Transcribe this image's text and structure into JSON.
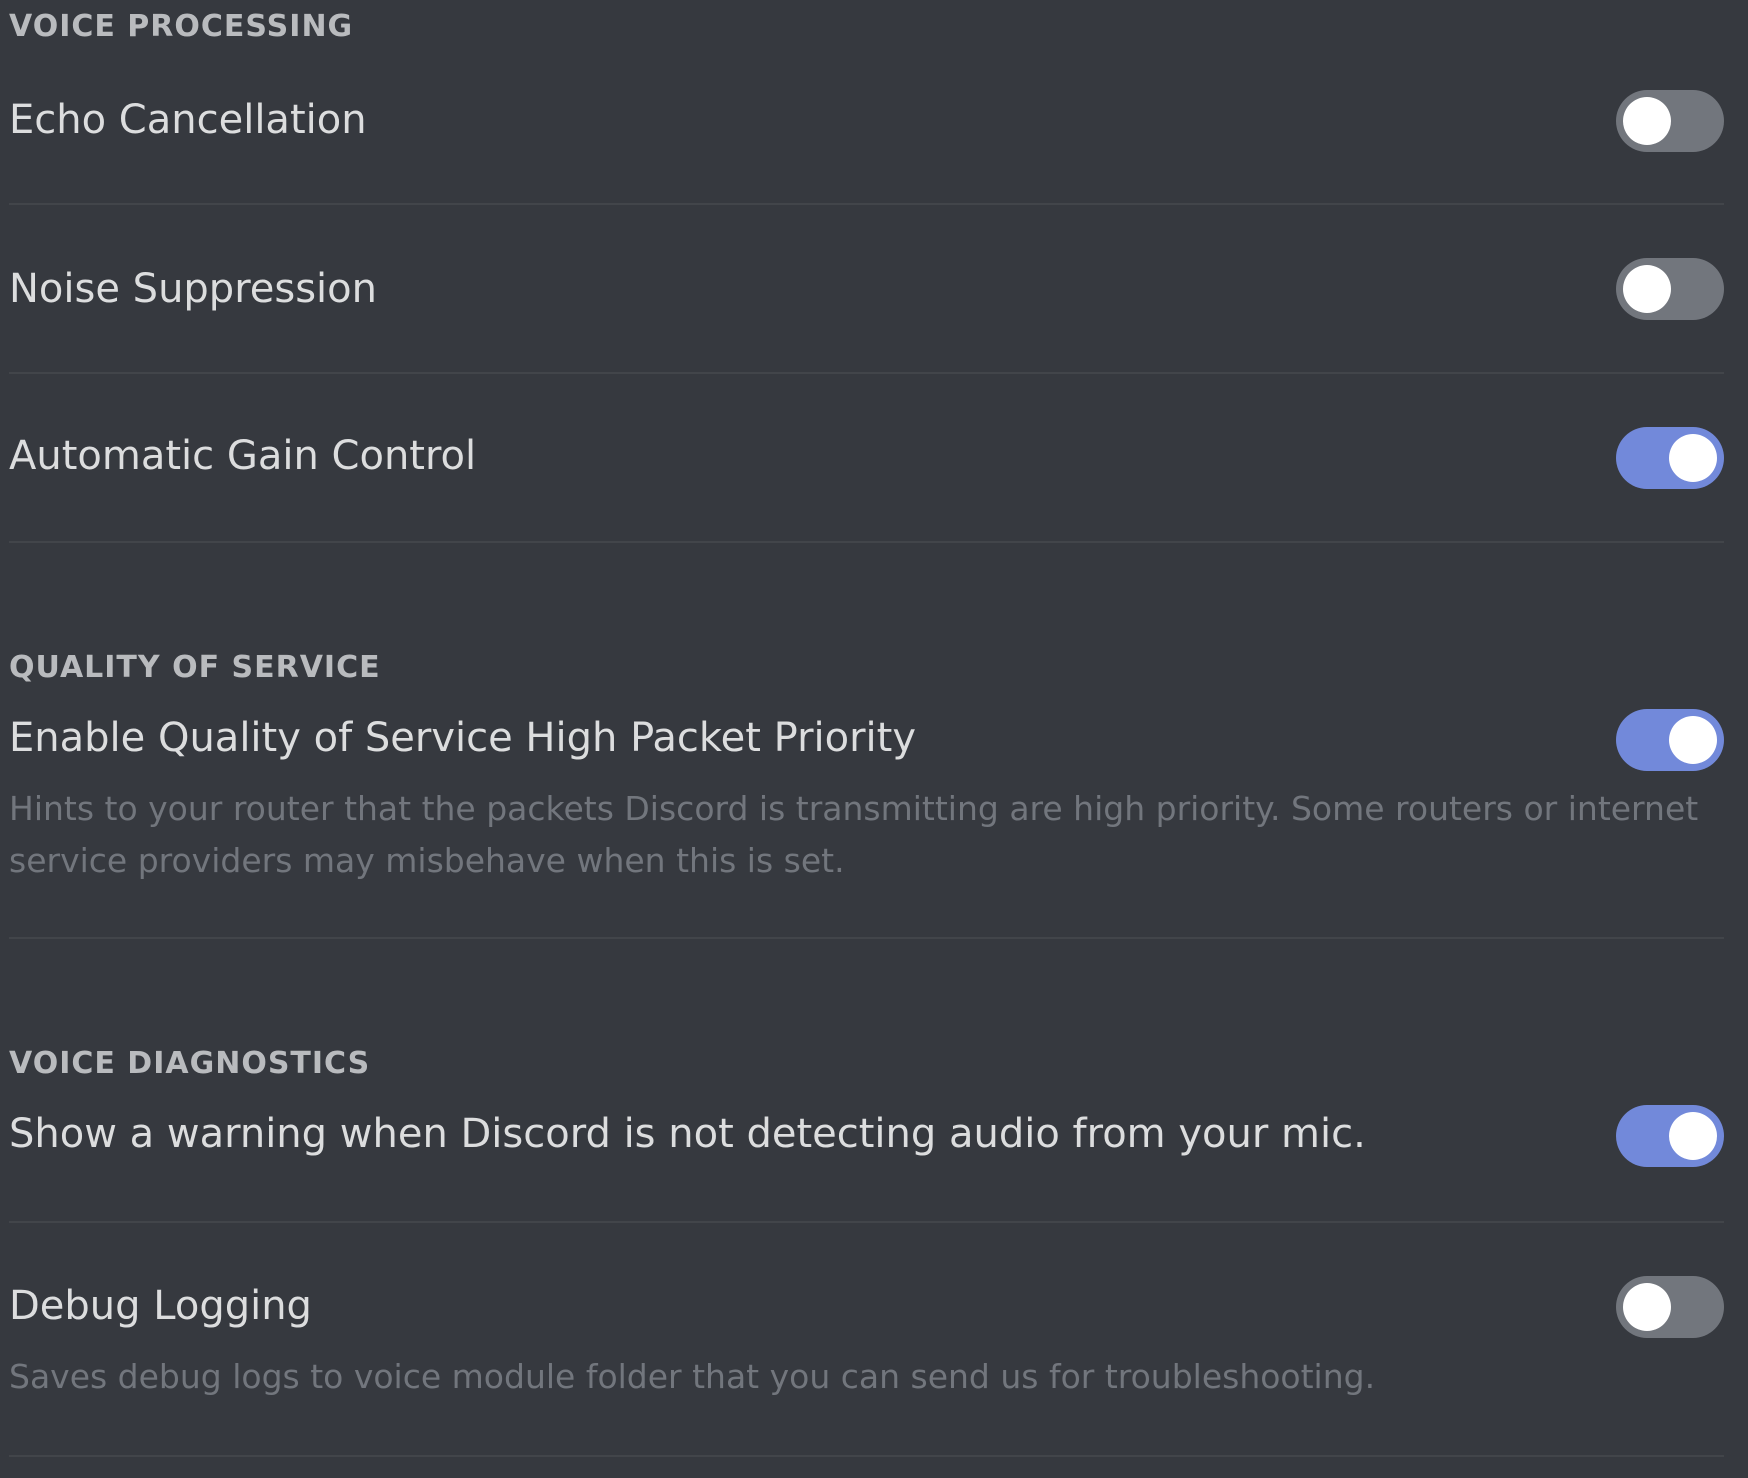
{
  "sections": {
    "voice_processing": {
      "header": "VOICE PROCESSING",
      "items": [
        {
          "label": "Echo Cancellation",
          "enabled": false
        },
        {
          "label": "Noise Suppression",
          "enabled": false
        },
        {
          "label": "Automatic Gain Control",
          "enabled": true
        }
      ]
    },
    "quality_of_service": {
      "header": "QUALITY OF SERVICE",
      "items": [
        {
          "label": "Enable Quality of Service High Packet Priority",
          "description": "Hints to your router that the packets Discord is transmitting are high priority. Some routers or internet service providers may misbehave when this is set.",
          "enabled": true
        }
      ]
    },
    "voice_diagnostics": {
      "header": "VOICE DIAGNOSTICS",
      "items": [
        {
          "label": "Show a warning when Discord is not detecting audio from your mic.",
          "enabled": true
        },
        {
          "label": "Debug Logging",
          "description": "Saves debug logs to voice module folder that you can send us for troubleshooting.",
          "enabled": false
        }
      ]
    }
  },
  "colors": {
    "background": "#36393f",
    "toggle_on": "#7289da",
    "toggle_off": "#72767d",
    "divider": "#42454a"
  }
}
